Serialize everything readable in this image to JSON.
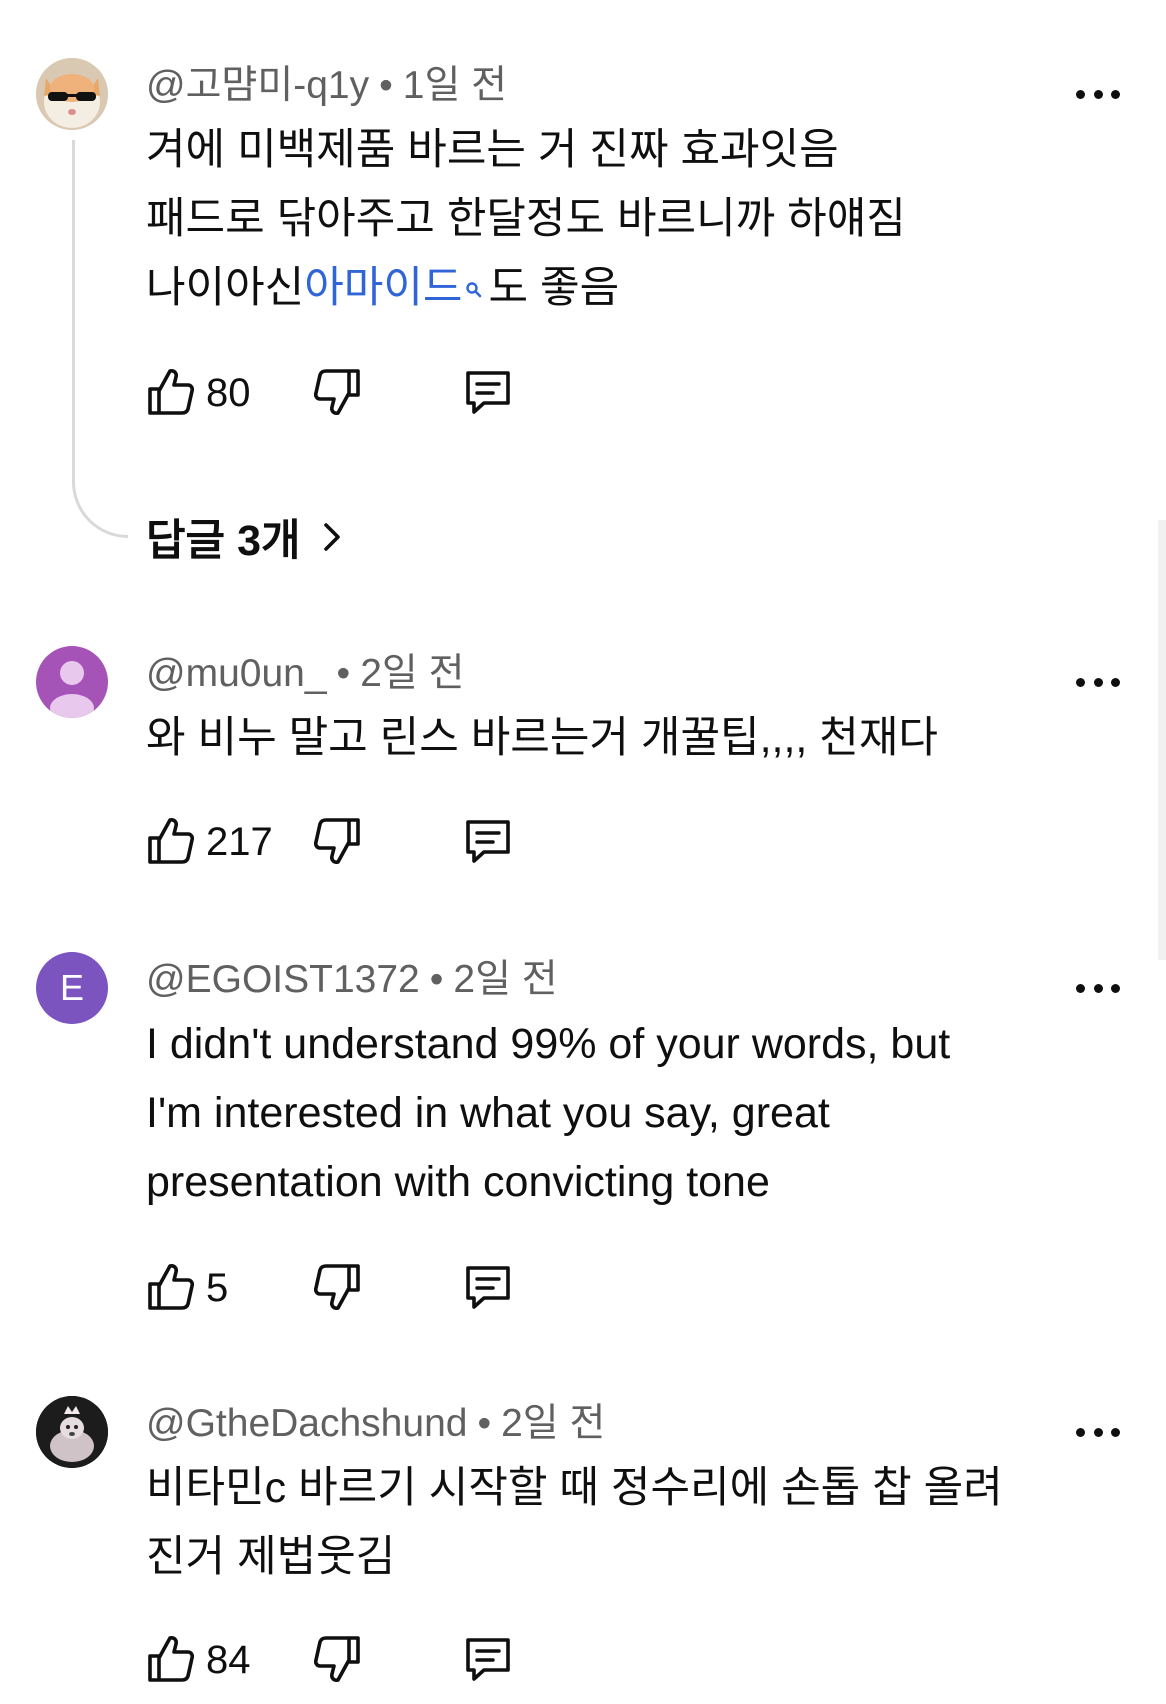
{
  "comments": [
    {
      "handle": "@고먐미-q1y",
      "time": "1일 전",
      "lines": [
        "겨에 미백제품 바르는 거 진짜 효과잇음",
        "패드로 닦아주고 한달정도 바르니까 하얘짐"
      ],
      "line3_prefix": "나이아신",
      "line3_link": "아마이드",
      "line3_suffix": "도 좋음",
      "likes": "80",
      "replies_label": "답글 3개",
      "avatar_icon": "cat-sunglasses-avatar"
    },
    {
      "handle": "@mu0un_",
      "time": "2일 전",
      "lines": [
        "와 비누 말고 린스 바르는거 개꿀팁,,,, 천재다"
      ],
      "likes": "217",
      "avatar_icon": "default-user-avatar",
      "avatar_color": "#a653b8"
    },
    {
      "handle": "@EGOIST1372",
      "time": "2일 전",
      "lines": [
        "I didn't understand 99% of your words, but",
        "I'm interested in what you say, great",
        "presentation with convicting tone"
      ],
      "likes": "5",
      "avatar_letter": "E",
      "avatar_color": "#7b54c0"
    },
    {
      "handle": "@GtheDachshund",
      "time": "2일 전",
      "lines": [
        "비타민c 바르기 시작할 때 정수리에 손톱 찹 올려",
        "진거 제법웃김"
      ],
      "likes": "84",
      "avatar_icon": "dachshund-photo-avatar"
    }
  ],
  "meta_separator": "•",
  "colors": {
    "link": "#3065d8",
    "meta": "#606060",
    "text": "#0f0f0f"
  }
}
